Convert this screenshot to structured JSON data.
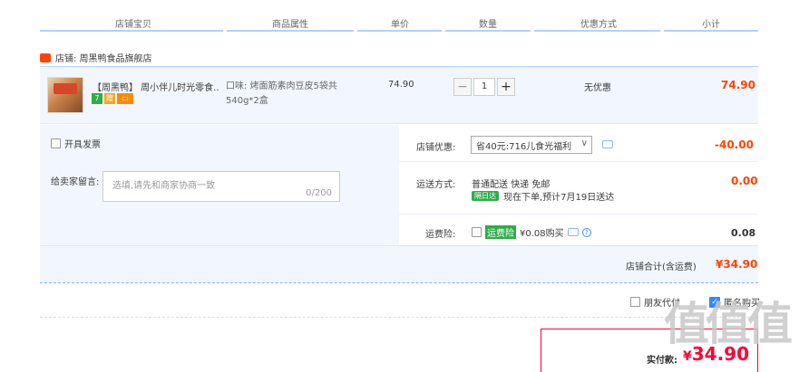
{
  "header": {
    "columns": [
      "店铺宝贝",
      "商品属性",
      "单价",
      "数量",
      "优惠方式",
      "小计"
    ]
  },
  "shop": {
    "label": "店铺: 周黑鸭食品旗舰店"
  },
  "item": {
    "title": "【周黑鸭】 周小伴儿时光零食...",
    "badges": [
      "7",
      "赠"
    ],
    "property": "口味: 烤面筋素肉豆皮5袋共540g*2盒",
    "unit_price": "74.90",
    "quantity": "1",
    "discount": "无优惠",
    "subtotal": "74.90"
  },
  "invoice": {
    "label": "开具发票"
  },
  "memo": {
    "label": "给卖家留言:",
    "placeholder": "选填,请先和商家协商一致",
    "count": "0/200"
  },
  "coupon": {
    "label": "店铺优惠:",
    "selected": "省40元:716儿食光福利",
    "value": "-40.00"
  },
  "shipping": {
    "label": "运送方式:",
    "method": "普通配送 快递 免邮",
    "tag": "隔日达",
    "note": "现在下单,预计7月19日送达",
    "value": "0.00"
  },
  "insurance": {
    "label": "运费险:",
    "tag": "运费险",
    "price": "¥0.08购买",
    "value": "0.08"
  },
  "shop_total": {
    "label": "店铺合计(含运费)",
    "value": "¥34.90"
  },
  "options": {
    "friend_pay": "朋友代付",
    "anonymous": "匿名购买"
  },
  "payment": {
    "label": "实付款:",
    "currency": "¥",
    "amount": "34.90"
  },
  "watermark": "值值值",
  "colors": {
    "accent": "#ff4400",
    "pay_red": "#ff0036",
    "band": "#f2f7ff",
    "line": "#b2d1ff"
  }
}
